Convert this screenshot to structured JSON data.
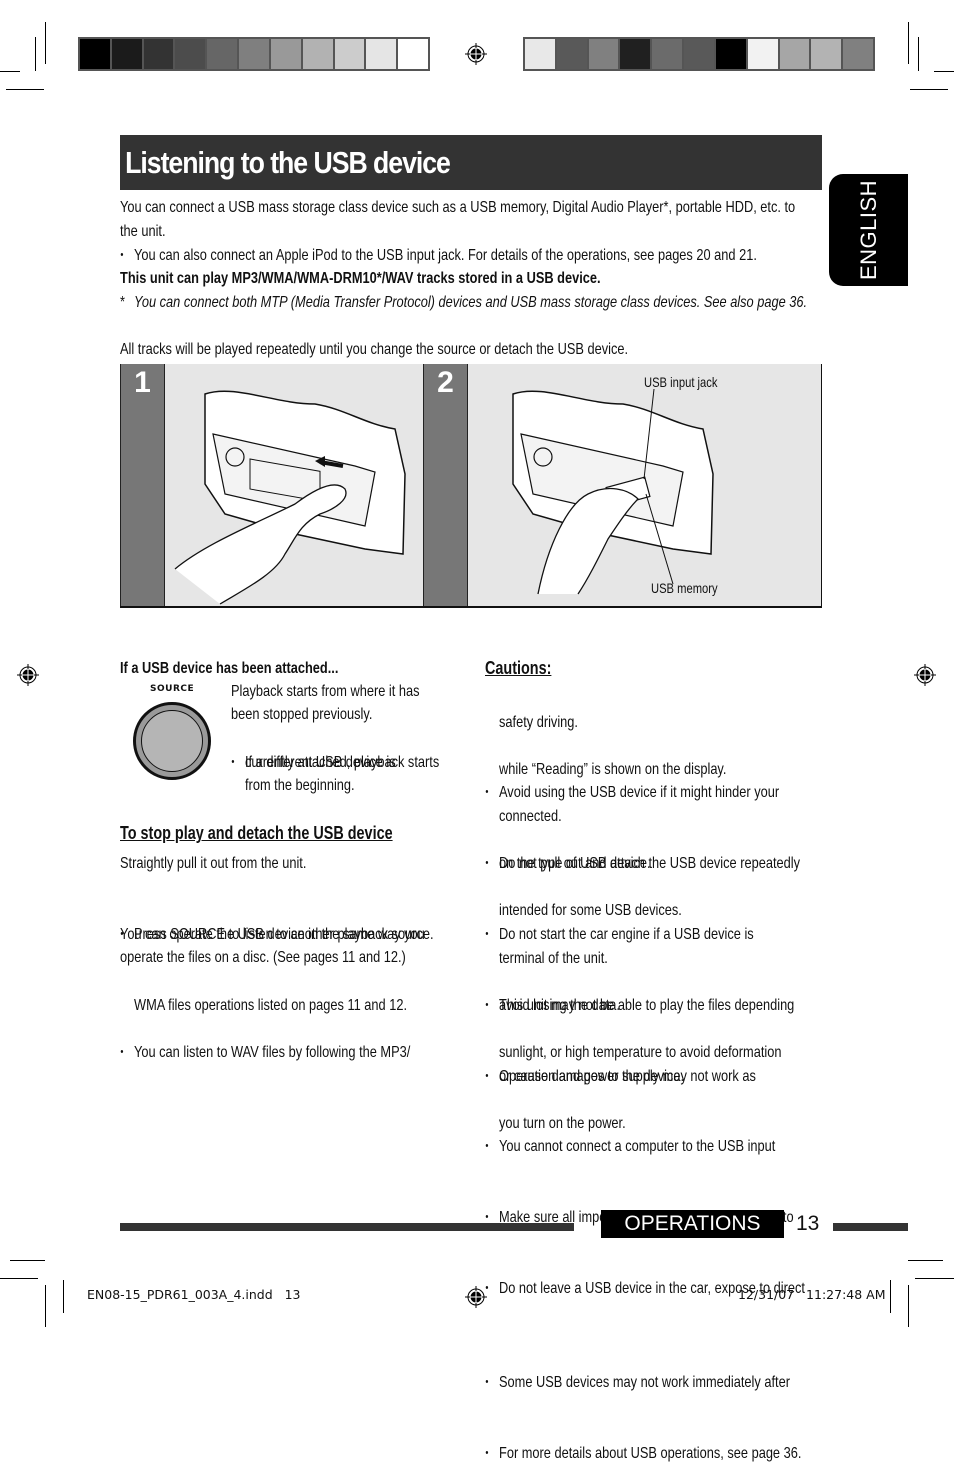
{
  "colorbar_left": [
    "#000000",
    "#1b1b1b",
    "#333333",
    "#4c4c4c",
    "#666666",
    "#7f7f7f",
    "#999999",
    "#b2b2b2",
    "#cccccc",
    "#e5e5e5",
    "#ffffff"
  ],
  "colorbar_right": [
    "#e8e8e8",
    "#595959",
    "#808080",
    "#202020",
    "#6b6b6b",
    "#595959",
    "#000000",
    "#f2f2f2",
    "#a6a6a6",
    "#b3b3b3",
    "#808080"
  ],
  "title": "Listening to the USB device",
  "language_tab": "ENGLISH",
  "intro": {
    "line1": "You can connect a USB mass storage class device such as a USB memory, Digital Audio Player*, portable HDD, etc. to",
    "line2": "the unit.",
    "bullet": "You can also connect an Apple iPod to the USB input jack. For details of the operations, see pages 20 and 21.",
    "bold_note": "This unit can play MP3/WMA/WMA-DRM10*/WAV tracks stored in a USB device.",
    "footnote_mark": "*",
    "footnote": "You can connect both MTP (Media Transfer Protocol) devices and USB mass storage class devices. See also page 36.",
    "repeat_note": "All tracks will be played repeatedly until you change the source or detach the USB device."
  },
  "steps": [
    {
      "number": "1"
    },
    {
      "number": "2",
      "labels": {
        "jack": "USB input jack",
        "memory": "USB memory"
      }
    }
  ],
  "attached": {
    "heading": "If a USB device has been attached...",
    "button_label": "SOURCE",
    "line1": "Playback starts from where it has",
    "line2": "been stopped previously.",
    "bullet_line1": "If a different USB device is",
    "bullet_line2": "currently attached, playback starts",
    "bullet_line3": "from the beginning."
  },
  "stop": {
    "heading": "To stop play and detach the USB device",
    "line1": "Straightly pull it out from the unit.",
    "bullet": "Press SOURCE to listen to another playback source.",
    "para_line1": "You can operate the USB device in the same way you",
    "para_line2": "operate the files on a disc. (See pages 11 and 12.)",
    "bullet2_line1": "You can listen to WAV files by following the MP3/",
    "bullet2_line2": "WMA files operations listed on pages 11 and 12."
  },
  "cautions": {
    "heading": "Cautions:",
    "items": [
      [
        "Avoid using the USB device if it might hinder your",
        "safety driving."
      ],
      [
        "Do not pull out and attach the USB device repeatedly",
        "while “Reading” is shown on the display."
      ],
      [
        "Do not start the car engine if a USB device is",
        "connected."
      ],
      [
        "This unit may not be able to play the files depending",
        "on the type of USB device."
      ],
      [
        "Operation and power supply may not work as",
        "intended for some USB devices."
      ],
      [
        "You cannot connect a computer to the USB input",
        "terminal of the unit."
      ],
      [
        "Make sure all important data has been backed up to",
        "avoid losing the data."
      ],
      [
        "Do not leave a USB device in the car, expose to direct",
        "sunlight, or high temperature to avoid deformation",
        "or cause damages to the device."
      ],
      [
        "Some USB devices may not work immediately after",
        "you turn on the power."
      ],
      [
        "For more details about USB operations, see page 36."
      ]
    ]
  },
  "footer": {
    "section": "OPERATIONS",
    "page_number": "13",
    "slug_file": "EN08-15_PDR61_003A_4.indd   13",
    "slug_date": "12/31/07   11:27:48 AM"
  }
}
